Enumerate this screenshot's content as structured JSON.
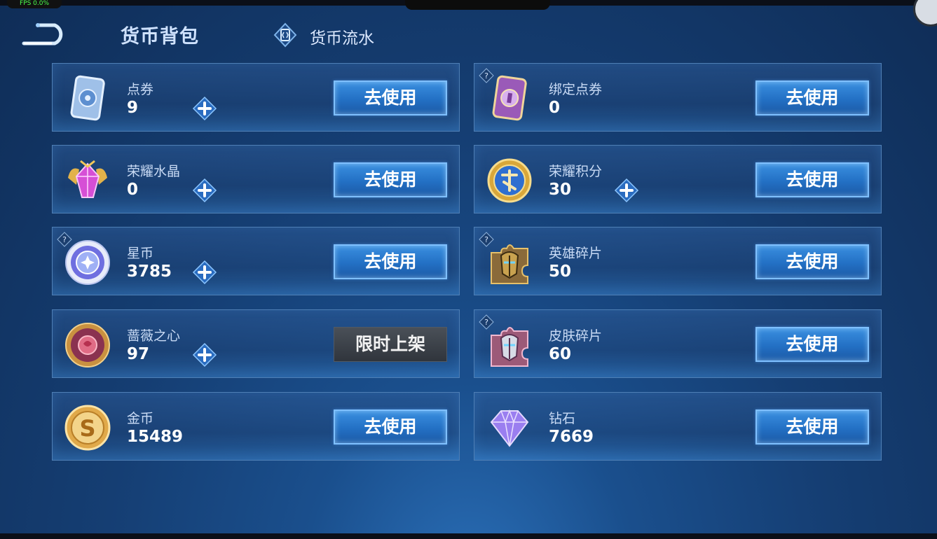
{
  "header": {
    "title": "货币背包",
    "flow_label": "货币流水"
  },
  "status": {
    "fps": "FPS 0.0%"
  },
  "currencies": [
    {
      "name": "点券",
      "amount": "9",
      "button": "去使用"
    },
    {
      "name": "绑定点券",
      "amount": "0",
      "button": "去使用"
    },
    {
      "name": "荣耀水晶",
      "amount": "0",
      "button": "去使用"
    },
    {
      "name": "荣耀积分",
      "amount": "30",
      "button": "去使用"
    },
    {
      "name": "星币",
      "amount": "3785",
      "button": "去使用"
    },
    {
      "name": "英雄碎片",
      "amount": "50",
      "button": "去使用"
    },
    {
      "name": "蔷薇之心",
      "amount": "97",
      "button": "限时上架"
    },
    {
      "name": "皮肤碎片",
      "amount": "60",
      "button": "去使用"
    },
    {
      "name": "金币",
      "amount": "15489",
      "button": "去使用"
    },
    {
      "name": "钻石",
      "amount": "7669",
      "button": "去使用"
    }
  ],
  "icons": {
    "back": "back-arrow-icon",
    "flow": "currency-flow-icon",
    "add": "plus-icon",
    "help": "question-icon"
  },
  "colors": {
    "button_blue": "#2370c4",
    "button_border": "#7fc0ff",
    "disabled_button": "#30353c",
    "background": "#153e73"
  }
}
